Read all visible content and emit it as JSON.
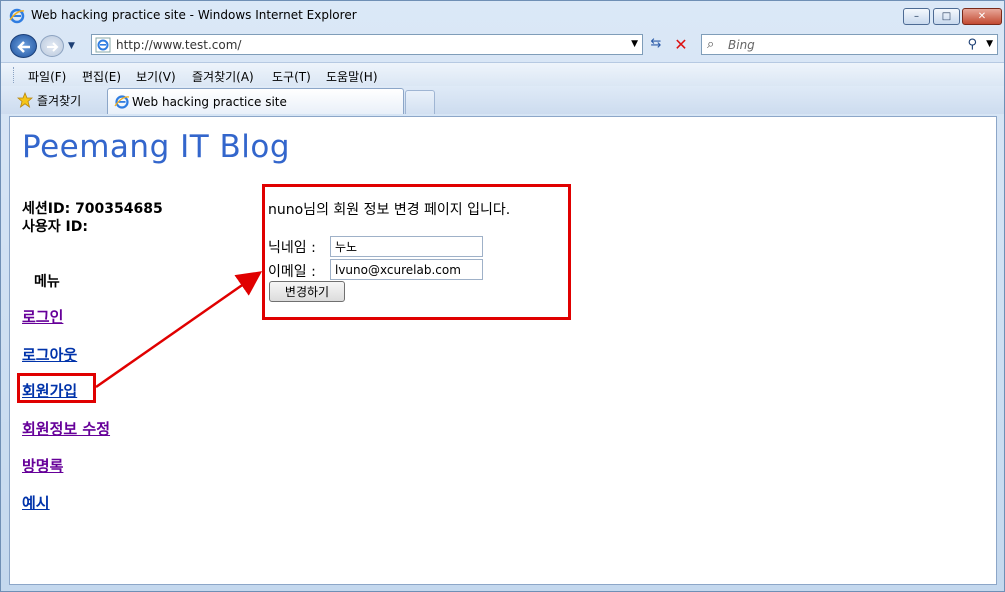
{
  "window": {
    "title": "Web hacking practice site - Windows Internet Explorer",
    "minimize_glyph": "–",
    "maximize_glyph": "□",
    "close_glyph": "✕"
  },
  "address": {
    "url": "http://www.test.com/",
    "search_placeholder": "Bing"
  },
  "menubar": {
    "items": [
      "파일(F)",
      "편집(E)",
      "보기(V)",
      "즐겨찾기(A)",
      "도구(T)",
      "도움말(H)"
    ]
  },
  "tabs": {
    "favorites_label": "즐겨찾기",
    "active_tab": "Web hacking practice site"
  },
  "page": {
    "blog_title": "Peemang IT Blog",
    "session_id": "세션ID: 700354685",
    "user_id": "사용자 ID:",
    "menu_heading": "메뉴",
    "nav": [
      "로그인",
      "로그아웃",
      "회원가입",
      "회원정보 수정",
      "방명록",
      "예시"
    ],
    "form": {
      "heading": "nuno님의 회원 정보 변경 페이지 입니다.",
      "nickname_label": "닉네임 :",
      "nickname_value": "누노",
      "email_label": "이메일 :",
      "email_value": "lvuno@xcurelab.com",
      "submit_label": "변경하기"
    }
  },
  "colors": {
    "title_blue": "#3366cc",
    "visited_link": "#660099",
    "link": "#0033aa",
    "highlight_red": "#e00000"
  }
}
